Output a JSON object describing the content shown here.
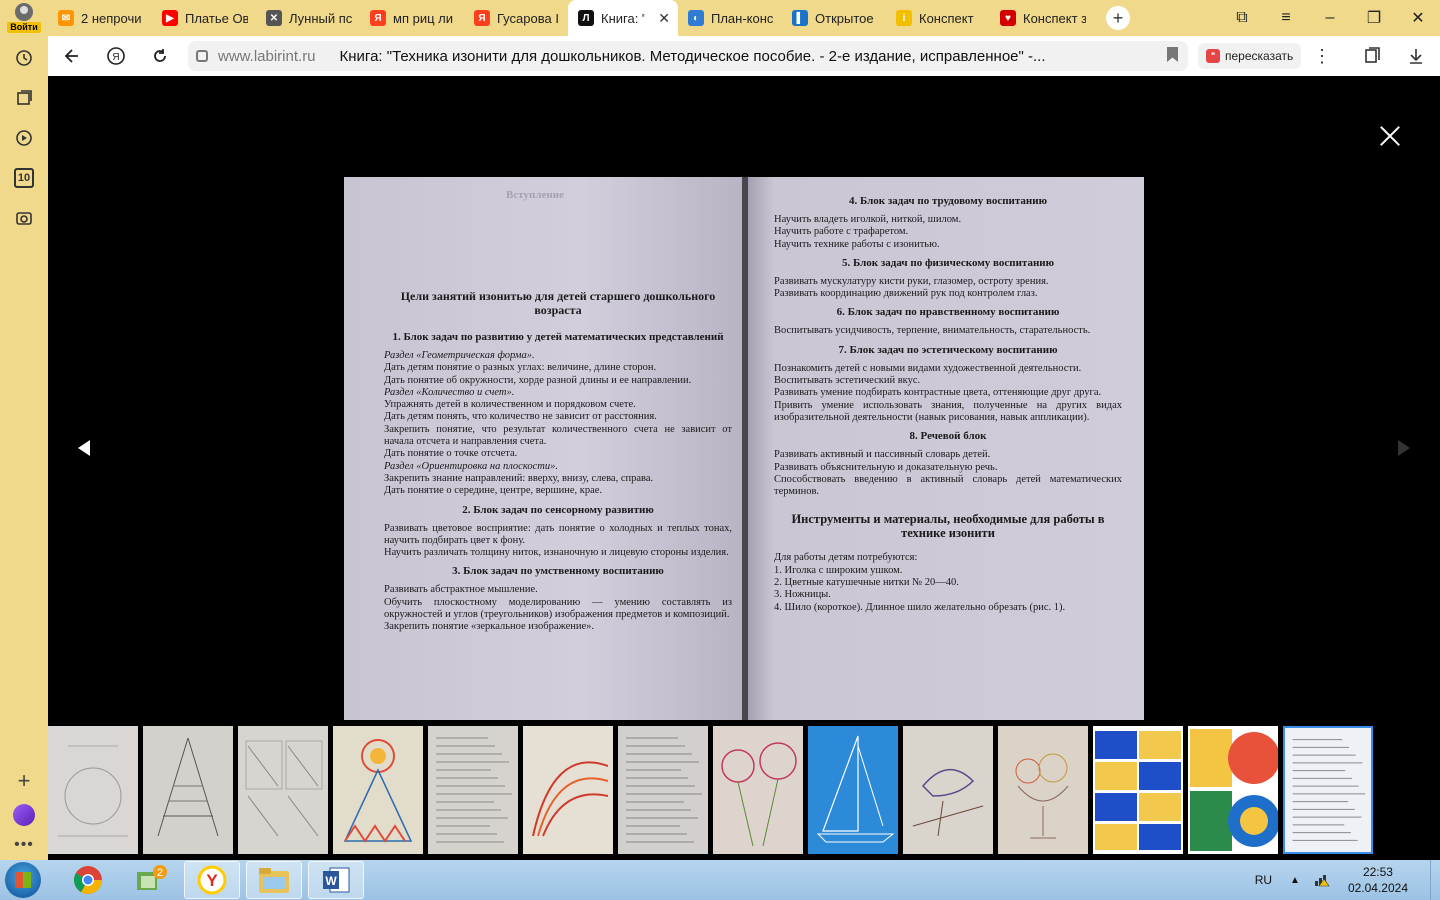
{
  "sidebar": {
    "login_label": "Войти",
    "icons": [
      "history-icon",
      "collections-icon",
      "video-icon",
      "ten-icon",
      "screenshot-icon"
    ],
    "ten_label": "10"
  },
  "tabs": [
    {
      "label": "2 непрочи",
      "icon": "mail-icon",
      "color": "#ff9500",
      "glyph": "✉"
    },
    {
      "label": "Платье Ов",
      "icon": "youtube-icon",
      "color": "#ff0000",
      "glyph": "▶"
    },
    {
      "label": "Лунный пс",
      "icon": "cat-icon",
      "color": "#555555",
      "glyph": "✕"
    },
    {
      "label": "мп риц ли",
      "icon": "yandex-icon",
      "color": "#fc3f1d",
      "glyph": "Я"
    },
    {
      "label": "Гусарова I",
      "icon": "yandex-icon",
      "color": "#fc3f1d",
      "glyph": "Я"
    },
    {
      "label": "Книга: \"",
      "icon": "labirint-icon",
      "color": "#111111",
      "glyph": "Л",
      "active": true
    },
    {
      "label": "План-конс",
      "icon": "globe-icon",
      "color": "#2f7bd6",
      "glyph": "◐"
    },
    {
      "label": "Открытое",
      "icon": "book-icon",
      "color": "#1a73c9",
      "glyph": "▌"
    },
    {
      "label": "Конспект",
      "icon": "info-icon",
      "color": "#f2c000",
      "glyph": "i"
    },
    {
      "label": "Конспект з",
      "icon": "heart-icon",
      "color": "#d40000",
      "glyph": "♥"
    }
  ],
  "address": {
    "domain": "www.labirint.ru",
    "title": "Книга: \"Техника изонити для дошкольников. Методическое пособие. - 2-е издание, исправленное\" -...",
    "retell_label": "пересказать"
  },
  "book": {
    "left": {
      "ghost": "Вступление",
      "title": "Цели занятий изонитью для детей старшего дошкольного возраста",
      "sections": [
        {
          "heading": "1. Блок задач по развитию у детей математических представлений",
          "lines": [
            {
              "t": "Раздел «Геометрическая форма».",
              "i": true
            },
            {
              "t": "Дать детям понятие о разных углах: величине, длине сторон."
            },
            {
              "t": "Дать понятие об окружности, хорде разной длины и ее направлении."
            },
            {
              "t": "Раздел «Количество и счет».",
              "i": true
            },
            {
              "t": "Упражнять детей в количественном и порядковом счете."
            },
            {
              "t": "Дать детям понять, что количество не зависит от расстояния."
            },
            {
              "t": "Закрепить понятие, что результат количественного счета не зависит от начала отсчета и направления счета."
            },
            {
              "t": "Дать понятие о точке отсчета."
            },
            {
              "t": "Раздел «Ориентировка на плоскости».",
              "i": true
            },
            {
              "t": "Закрепить знание направлений: вверху, внизу, слева, справа."
            },
            {
              "t": "Дать понятие о середине, центре, вершине, крае."
            }
          ]
        },
        {
          "heading": "2. Блок задач по сенсорному развитию",
          "lines": [
            {
              "t": "Развивать цветовое восприятие: дать понятие о холодных и теплых тонах, научить подбирать цвет к фону."
            },
            {
              "t": "Научить различать толщину ниток, изнаночную и лицевую стороны изделия."
            }
          ]
        },
        {
          "heading": "3. Блок задач по умственному воспитанию",
          "lines": [
            {
              "t": "Развивать абстрактное мышление."
            },
            {
              "t": "Обучить плоскостному моделированию — умению составлять из окружностей и углов (треугольников) изображения предметов и композиций."
            },
            {
              "t": "Закрепить понятие «зеркальное изображение»."
            }
          ]
        }
      ]
    },
    "right": {
      "sections": [
        {
          "heading": "4. Блок задач по трудовому воспитанию",
          "lines": [
            {
              "t": "Научить владеть иголкой, ниткой, шилом."
            },
            {
              "t": "Научить работе с трафаретом."
            },
            {
              "t": "Научить технике работы с изонитью."
            }
          ]
        },
        {
          "heading": "5. Блок задач по физическому воспитанию",
          "lines": [
            {
              "t": "Развивать мускулатуру кисти руки, глазомер, остроту зрения."
            },
            {
              "t": "Развивать координацию движений рук под контролем глаз."
            }
          ]
        },
        {
          "heading": "6. Блок задач по нравственному воспитанию",
          "lines": [
            {
              "t": "Воспитывать усидчивость, терпение, внимательность, старательность."
            }
          ]
        },
        {
          "heading": "7. Блок задач по эстетическому воспитанию",
          "lines": [
            {
              "t": "Познакомить детей с новыми видами художественной деятельности."
            },
            {
              "t": "Воспитывать эстетический вкус."
            },
            {
              "t": "Развивать умение подбирать контрастные цвета, оттеняющие друг друга."
            },
            {
              "t": "Привить умение использовать знания, полученные на других видах изобразительной деятельности (навык рисования, навык аппликации)."
            }
          ]
        },
        {
          "heading": "8. Речевой блок",
          "lines": [
            {
              "t": "Развивать активный и пассивный словарь детей."
            },
            {
              "t": "Развивать объяснительную и доказательную речь."
            },
            {
              "t": "Способствовать введению в активный словарь детей математических терминов."
            }
          ]
        }
      ],
      "tools_title": "Инструменты и материалы, необходимые для работы в технике изонити",
      "tools_lines": [
        "Для работы детям потребуются:",
        "1. Иголка с широким ушком.",
        "2. Цветные катушечные нитки № 20—40.",
        "3. Ножницы.",
        "4. Шило (короткое). Длинное шило желательно обрезать (рис. 1)."
      ]
    }
  },
  "thumbnails": [
    {
      "name": "thumb-1",
      "kind": "circle-sketch",
      "bg": "#d9d6d3"
    },
    {
      "name": "thumb-2",
      "kind": "triangle-sketch",
      "bg": "#d4d1cc"
    },
    {
      "name": "thumb-3",
      "kind": "grid-sketch",
      "bg": "#d8d4cf"
    },
    {
      "name": "thumb-4",
      "kind": "sun-triangle",
      "bg": "#e2dccb"
    },
    {
      "name": "thumb-5",
      "kind": "text-page",
      "bg": "#d6d3ce"
    },
    {
      "name": "thumb-6",
      "kind": "red-curves",
      "bg": "#e6e0d4"
    },
    {
      "name": "thumb-7",
      "kind": "text-page",
      "bg": "#d2d0ce"
    },
    {
      "name": "thumb-8",
      "kind": "red-flowers",
      "bg": "#ddd4cd"
    },
    {
      "name": "thumb-9",
      "kind": "blue-sail",
      "bg": "#2c8ad8"
    },
    {
      "name": "thumb-10",
      "kind": "bird-sketch",
      "bg": "#d9d4cc"
    },
    {
      "name": "thumb-11",
      "kind": "fruit-vase",
      "bg": "#dcd3c8"
    },
    {
      "name": "thumb-12",
      "kind": "blue-yellow-grid",
      "bg": "#ffffff"
    },
    {
      "name": "thumb-13",
      "kind": "colorful-grid",
      "bg": "#ffffff"
    },
    {
      "name": "thumb-14",
      "kind": "text-page",
      "bg": "#eef2f6",
      "selected": true
    }
  ],
  "taskbar": {
    "apps": [
      "chrome-icon",
      "files-badge-icon",
      "yandex-browser-icon",
      "explorer-icon",
      "word-icon"
    ],
    "badge": "2",
    "lang": "RU",
    "time": "22:53",
    "date": "02.04.2024"
  }
}
